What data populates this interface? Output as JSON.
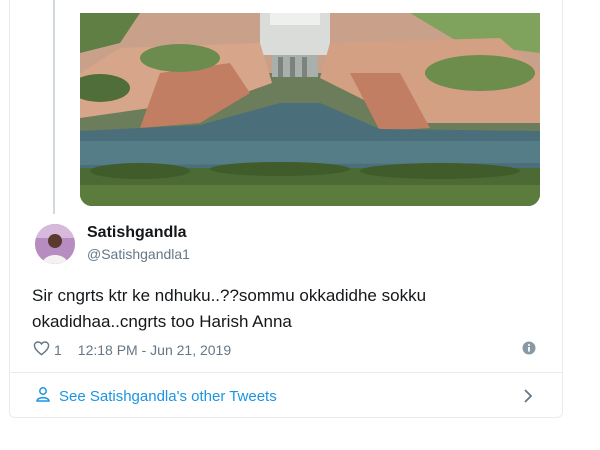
{
  "tweet": {
    "author_name": "Satishgandla",
    "author_handle": "@Satishgandla1",
    "text_line1": "Sir cngrts ktr ke ndhuku..??sommu okkadidhe sokku",
    "text_line2": "okadidhaa..cngrts too Harish Anna",
    "like_count": "1",
    "timestamp": "12:18 PM - Jun 21, 2019"
  },
  "footer": {
    "other_tweets_label": "See Satishgandla's other Tweets"
  },
  "icons": {
    "like": "heart-outline-icon",
    "info": "info-icon",
    "person": "person-icon",
    "chevron": "chevron-right-icon"
  },
  "colors": {
    "link": "#1b95e0",
    "secondary_text": "#657786",
    "border": "#e6ecf0"
  }
}
